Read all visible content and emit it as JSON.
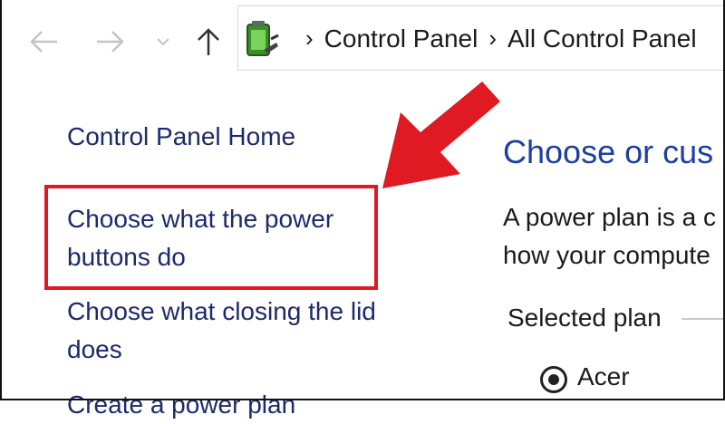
{
  "window": {
    "colors": {
      "link": "#1c2a6b",
      "heading": "#1e3fa0",
      "annotation_red": "#e01a22"
    }
  },
  "navigation": {
    "back_icon": "arrow-left-icon",
    "forward_icon": "arrow-right-icon",
    "recent_icon": "chevron-down-icon",
    "up_icon": "arrow-up-icon"
  },
  "address_bar": {
    "icon": "power-options-icon",
    "breadcrumbs": [
      "Control Panel",
      "All Control Panel"
    ]
  },
  "sidebar": {
    "items": [
      {
        "label": "Control Panel Home"
      },
      {
        "label_line1": "Choose what the power",
        "label_line2": "buttons do"
      },
      {
        "label_line1": "Choose what closing the lid",
        "label_line2": "does"
      },
      {
        "label": "Create a power plan"
      }
    ]
  },
  "main": {
    "heading": "Choose or cus",
    "description_line1": "A power plan is a c",
    "description_line2": "how your compute",
    "selected_plan_label": "Selected plan",
    "plan_name": "Acer"
  }
}
